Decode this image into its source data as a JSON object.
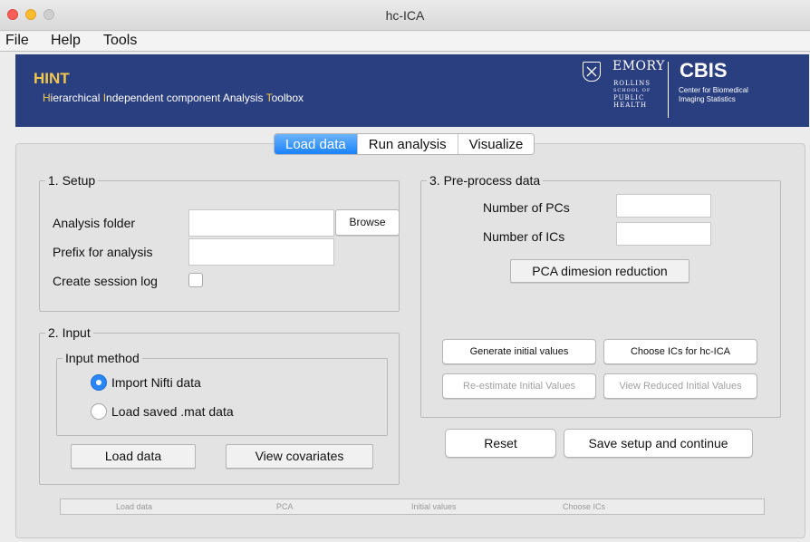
{
  "window": {
    "title": "hc-ICA"
  },
  "menu": {
    "items": [
      "File",
      "Help",
      "Tools"
    ]
  },
  "banner": {
    "title": "HINT",
    "subtitle_parts": [
      "H",
      "ierarchical ",
      "I",
      "ndependent component Analysis ",
      "T",
      "oolbox"
    ],
    "emory": "EMORY",
    "rollins_lines": [
      "ROLLINS",
      "SCHOOL OF",
      "PUBLIC",
      "HEALTH"
    ],
    "cbis": "CBIS",
    "cbis_sub_lines": [
      "Center for Biomedical",
      "Imaging Statistics"
    ],
    "colors": {
      "background": "#2a3f7f",
      "accent": "#f2c84b"
    }
  },
  "tabs": [
    "Load data",
    "Run analysis",
    "Visualize"
  ],
  "active_tab": "Load data",
  "setup": {
    "title": "1. Setup",
    "analysis_folder_label": "Analysis folder",
    "analysis_folder_value": "",
    "browse_label": "Browse",
    "prefix_label": "Prefix for analysis",
    "prefix_value": "",
    "session_log_label": "Create session log",
    "session_log_checked": false
  },
  "input": {
    "title": "2. Input",
    "method_title": "Input method",
    "option_nifti": "Import Nifti data",
    "option_mat": "Load saved .mat data",
    "selected": "Import Nifti data",
    "load_button": "Load data",
    "covariates_button": "View covariates"
  },
  "preprocess": {
    "title": "3. Pre-process data",
    "pcs_label": "Number of PCs",
    "pcs_value": "",
    "ics_label": "Number of ICs",
    "ics_value": "",
    "pca_button": "PCA dimesion reduction",
    "generate_button": "Generate initial values",
    "choose_button": "Choose ICs for hc-ICA",
    "reestimate_button": "Re-estimate Initial Values",
    "view_reduced_button": "View Reduced Initial Values"
  },
  "actions": {
    "reset": "Reset",
    "save": "Save setup and continue"
  },
  "progress": {
    "steps": [
      "Load data",
      "PCA",
      "Initial values",
      "Choose ICs"
    ]
  },
  "icons": {
    "emory_shield": "shield-icon"
  }
}
